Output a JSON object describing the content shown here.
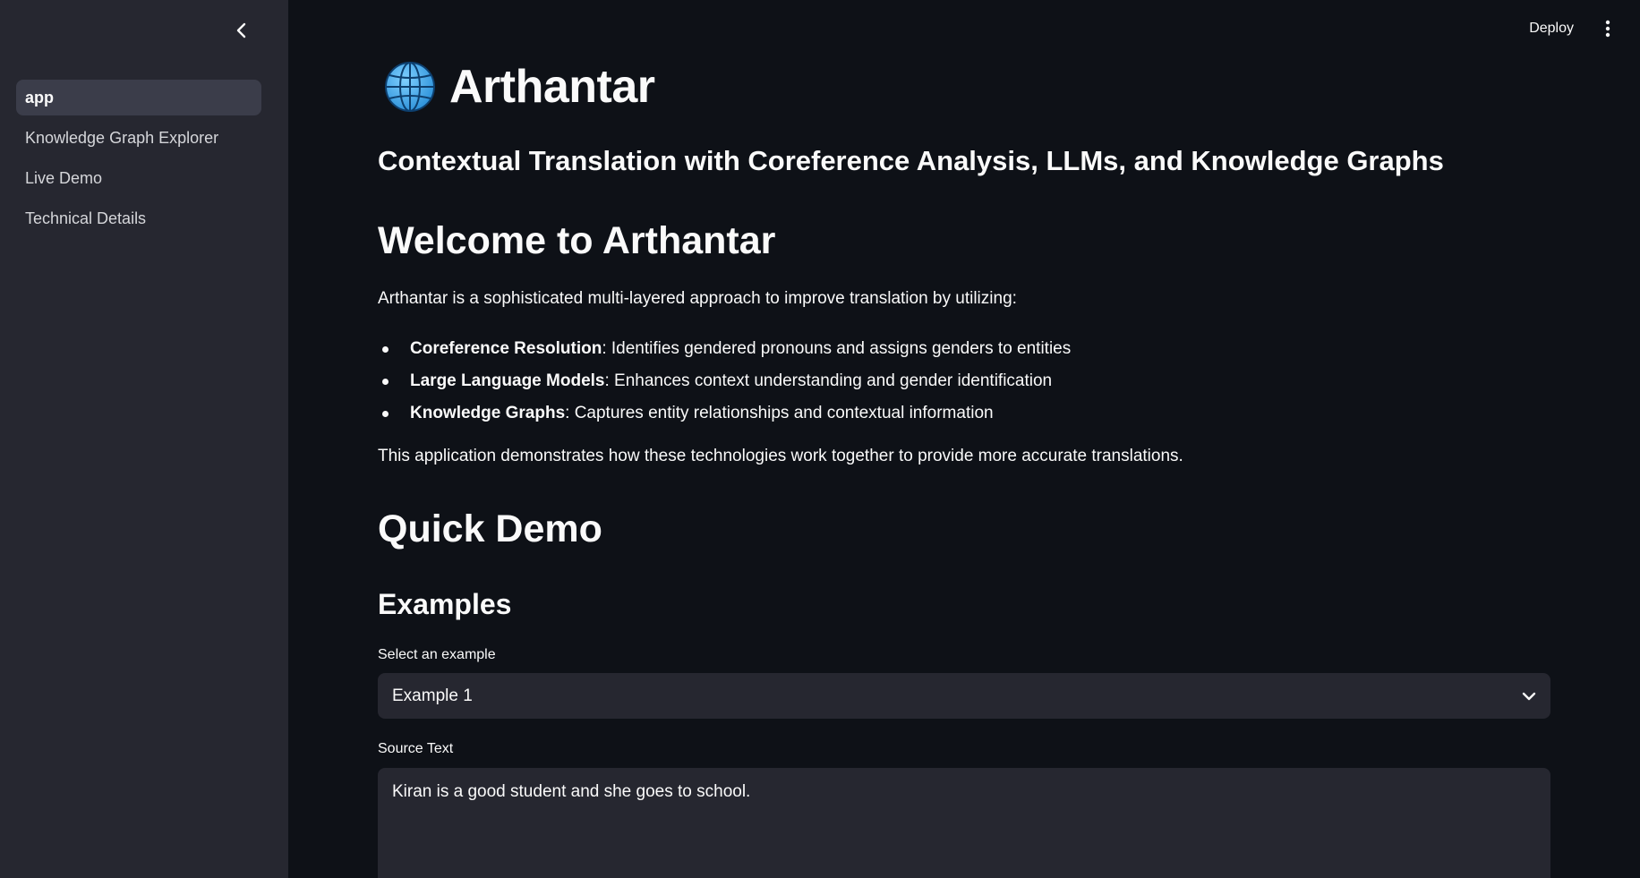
{
  "sidebar": {
    "items": [
      {
        "label": "app"
      },
      {
        "label": "Knowledge Graph Explorer"
      },
      {
        "label": "Live Demo"
      },
      {
        "label": "Technical Details"
      }
    ]
  },
  "header": {
    "deploy_label": "Deploy"
  },
  "main": {
    "title": "Arthantar",
    "subtitle": "Contextual Translation with Coreference Analysis, LLMs, and Knowledge Graphs",
    "welcome_heading": "Welcome to Arthantar",
    "intro": "Arthantar is a sophisticated multi-layered approach to improve translation by utilizing:",
    "bullets": [
      {
        "term": "Coreference Resolution",
        "desc": ": Identifies gendered pronouns and assigns genders to entities"
      },
      {
        "term": "Large Language Models",
        "desc": ": Enhances context understanding and gender identification"
      },
      {
        "term": "Knowledge Graphs",
        "desc": ": Captures entity relationships and contextual information"
      }
    ],
    "closing": "This application demonstrates how these technologies work together to provide more accurate translations.",
    "quick_demo_heading": "Quick Demo",
    "examples_heading": "Examples",
    "select_label": "Select an example",
    "select_value": "Example 1",
    "source_label": "Source Text",
    "source_value": "Kiran is a good student and she goes to school."
  },
  "colors": {
    "background": "#0e1117",
    "sidebar": "#262730",
    "active_item": "#3b3d4a",
    "input_bg": "#262730",
    "text": "#fafafa"
  },
  "icons": {
    "collapse": "chevron-left-icon",
    "menu": "vertical-dots-icon",
    "title": "globe-icon",
    "select": "chevron-down-icon"
  }
}
